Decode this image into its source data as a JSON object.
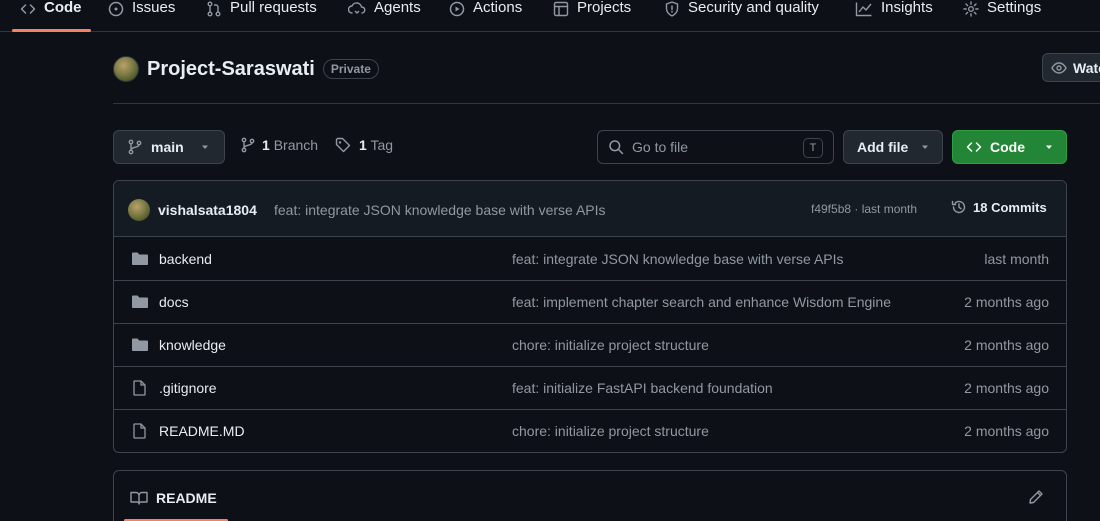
{
  "nav": {
    "tabs": [
      {
        "label": "Code",
        "icon": "code-icon",
        "active": true
      },
      {
        "label": "Issues",
        "icon": "issue-opened-icon"
      },
      {
        "label": "Pull requests",
        "icon": "git-pull-request-icon"
      },
      {
        "label": "Agents",
        "icon": "agent-icon"
      },
      {
        "label": "Actions",
        "icon": "play-icon"
      },
      {
        "label": "Projects",
        "icon": "table-icon"
      },
      {
        "label": "Security and quality",
        "icon": "shield-icon"
      },
      {
        "label": "Insights",
        "icon": "graph-icon"
      },
      {
        "label": "Settings",
        "icon": "gear-icon"
      }
    ]
  },
  "repo": {
    "name": "Project-Saraswati",
    "visibility": "Private",
    "watch_label": "Watch"
  },
  "toolbar": {
    "branch": "main",
    "branch_count": "1",
    "branch_label": "Branch",
    "tag_count": "1",
    "tag_label": "Tag",
    "search_placeholder": "Go to file",
    "search_shortcut": "T",
    "add_file_label": "Add file",
    "code_label": "Code"
  },
  "latest_commit": {
    "author": "vishalsata1804",
    "message": "feat: integrate JSON knowledge base with verse APIs",
    "hash_time": "f49f5b8 · last month",
    "commits_label": "18 Commits"
  },
  "files": [
    {
      "name": "backend",
      "type": "folder",
      "commit": "feat: integrate JSON knowledge base with verse APIs",
      "time": "last month"
    },
    {
      "name": "docs",
      "type": "folder",
      "commit": "feat: implement chapter search and enhance Wisdom Engine",
      "time": "2 months ago"
    },
    {
      "name": "knowledge",
      "type": "folder",
      "commit": "chore: initialize project structure",
      "time": "2 months ago"
    },
    {
      "name": ".gitignore",
      "type": "file",
      "commit": "feat: initialize FastAPI backend foundation",
      "time": "2 months ago"
    },
    {
      "name": "README.MD",
      "type": "file",
      "commit": "chore: initialize project structure",
      "time": "2 months ago"
    }
  ],
  "readme": {
    "title": "README"
  },
  "colors": {
    "background": "#0d1117",
    "accent_underline": "#f78166",
    "code_button": "#238636"
  }
}
